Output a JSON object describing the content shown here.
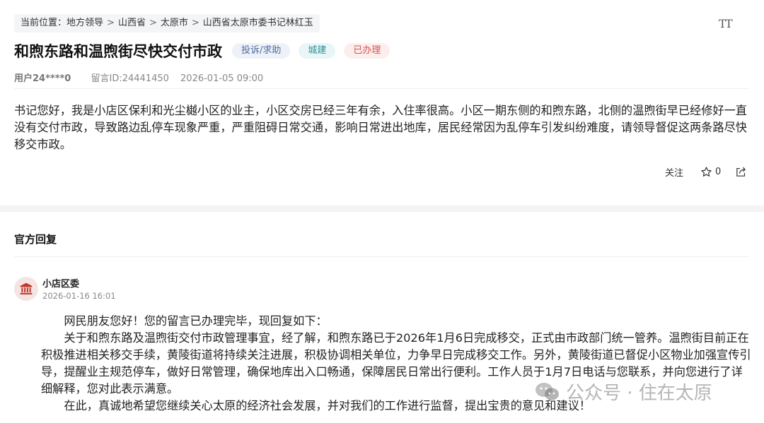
{
  "breadcrumb": {
    "prefix": "当前位置：",
    "items": [
      "地方领导",
      "山西省",
      "太原市",
      "山西省太原市委书记林红玉"
    ],
    "separator": ">"
  },
  "font_toggle": "TT",
  "post": {
    "title": "和煦东路和温煦街尽快交付市政",
    "tags": [
      {
        "label": "投诉/求助",
        "bg": "#eef2f8",
        "color": "#4d6a9a"
      },
      {
        "label": "城建",
        "bg": "#e8f6f7",
        "color": "#2f8f9a"
      },
      {
        "label": "已办理",
        "bg": "#fdeeee",
        "color": "#d9534f"
      }
    ],
    "user": "用户24****0",
    "message_id": "留言ID:24441450",
    "date": "2026-01-05 09:00",
    "content": "书记您好，我是小店区保利和光尘樾小区的业主，小区交房已经三年有余，入住率很高。小区一期东侧的和煦东路，北侧的温煦街早已经修好一直没有交付市政，导致路边乱停车现象严重，严重阻碍日常交通，影响日常进出地库，居民经常因为乱停车引发纠纷难度，请领导督促这两条路尽快移交市政。",
    "follow_label": "关注",
    "like_count": "0"
  },
  "reply_section": {
    "title": "官方回复",
    "org": "小店区委",
    "time": "2026-01-16 16:01",
    "paragraphs": [
      "网民朋友您好！您的留言已办理完毕，现回复如下：",
      "关于和煦东路及温煦街交付市政管理事宜，经了解，和煦东路已于2026年1月6日完成移交，正式由市政部门统一管养。温煦街目前正在积极推进相关移交手续，黄陵街道将持续关注进展，积极协调相关单位，力争早日完成移交工作。另外，黄陵街道已督促小区物业加强宣传引导，提醒业主规范停车，做好日常管理，确保地库出入口畅通，保障居民日常出行便利。工作人员于1月7日电话与您联系，并向您进行了详细解释，您对此表示满意。",
      "在此，真诚地希望您继续关心太原的经济社会发展，并对我们的工作进行监督，提出宝贵的意见和建议！"
    ]
  },
  "watermark": "公众号 · 住在太原",
  "colors": {
    "avatar_icon": "#c0392b",
    "band": "#f3f4f6"
  }
}
